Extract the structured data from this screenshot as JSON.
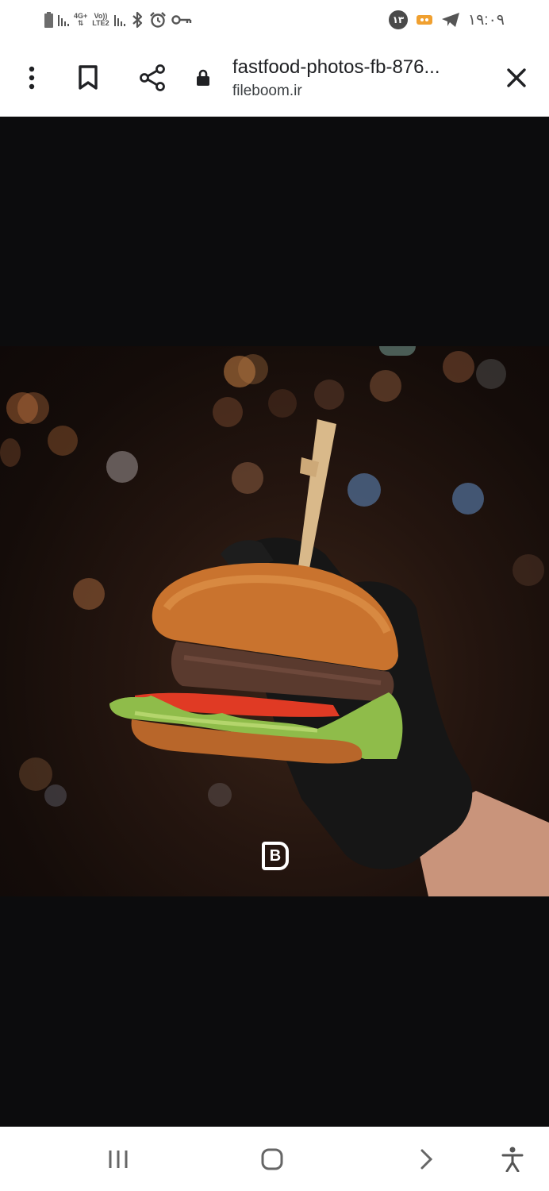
{
  "status_bar": {
    "network_top": "4G+",
    "network_volte": "Vo))",
    "network_lte": "LTE2",
    "notification_badge": "۱۳",
    "time": "۱۹:۰۹",
    "icons": [
      "battery-icon",
      "signal-icon",
      "bluetooth-icon",
      "alarm-icon",
      "vpn-key-icon",
      "app-notification-icon",
      "telegram-icon"
    ]
  },
  "toolbar": {
    "title": "fastfood-photos-fb-876...",
    "domain": "fileboom.ir",
    "icons": [
      "more-vert-icon",
      "bookmark-icon",
      "share-icon",
      "lock-icon",
      "close-icon"
    ]
  },
  "content": {
    "image_subject": "burger-held-in-gloved-hand",
    "watermark": "B",
    "background_color": "#0c0c0d"
  },
  "nav_bar": {
    "icons": [
      "recents-icon",
      "home-icon",
      "back-icon",
      "accessibility-icon"
    ]
  },
  "colors": {
    "status_bar_bg": "#ffffff",
    "toolbar_bg": "#ffffff",
    "page_bg": "#0c0c0d",
    "icon_color": "#202124"
  }
}
